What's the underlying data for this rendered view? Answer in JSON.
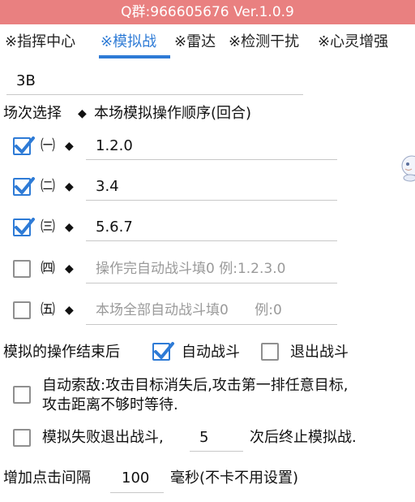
{
  "title_bar": {
    "text": "Q群:966605676 Ver.1.0.9"
  },
  "tabs": [
    {
      "label": "※指挥中心"
    },
    {
      "label": "※模拟战",
      "active": true
    },
    {
      "label": "※雷达"
    },
    {
      "label": "※检测干扰"
    },
    {
      "label": "※心灵增强"
    }
  ],
  "mode_field": {
    "value": "3B"
  },
  "section_header": {
    "left": "场次选择",
    "diamond": "◆",
    "right": "本场模拟操作顺序(回合)"
  },
  "rounds": [
    {
      "checked": true,
      "label": "㈠",
      "value": "1.2.0",
      "placeholder": ""
    },
    {
      "checked": true,
      "label": "㈡",
      "value": "3.4",
      "placeholder": ""
    },
    {
      "checked": true,
      "label": "㈢",
      "value": "5.6.7",
      "placeholder": ""
    },
    {
      "checked": false,
      "label": "㈣",
      "value": "",
      "placeholder": "操作完自动战斗填0  例:1.2.3.0"
    },
    {
      "checked": false,
      "label": "㈤",
      "value": "",
      "placeholder": "本场全部自动战斗填0      例:0"
    }
  ],
  "after_ops": {
    "label": "模拟的操作结束后",
    "auto_battle": {
      "label": "自动战斗",
      "checked": true
    },
    "exit_battle": {
      "label": "退出战斗",
      "checked": false
    }
  },
  "auto_search": {
    "checked": false,
    "line1": "自动索敌:攻击目标消失后,攻击第一排任意目标,",
    "line2": "攻击距离不够时等待."
  },
  "fail_exit": {
    "checked": false,
    "prefix": "模拟失败退出战斗,",
    "value": "5",
    "suffix": "次后终止模拟战."
  },
  "click_interval": {
    "label": "增加点击间隔",
    "value": "100",
    "unit": "毫秒(不卡不用设置)"
  },
  "colors": {
    "title_bg": "#e98080",
    "accent": "#2e7bd6",
    "check_border": "#8f8f8f"
  }
}
